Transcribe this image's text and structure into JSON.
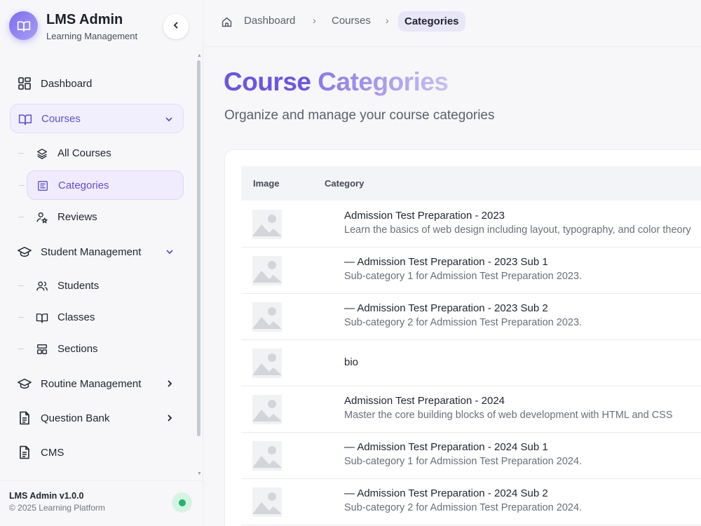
{
  "brand": {
    "title": "LMS Admin",
    "subtitle": "Learning Management",
    "logo_icon": "book-open-icon"
  },
  "nav": {
    "dashboard": "Dashboard",
    "courses": "Courses",
    "all_courses": "All Courses",
    "categories": "Categories",
    "reviews": "Reviews",
    "student_management": "Student Management",
    "students": "Students",
    "classes": "Classes",
    "sections": "Sections",
    "routine_management": "Routine Management",
    "question_bank": "Question Bank",
    "cms": "CMS"
  },
  "footer": {
    "version": "LMS Admin v1.0.0",
    "copyright": "© 2025 Learning Platform",
    "status_color": "#22b566"
  },
  "breadcrumb": {
    "items": [
      "Dashboard",
      "Courses"
    ],
    "current": "Categories"
  },
  "page": {
    "title_part1": "Course",
    "title_part2": "Categories",
    "subtitle": "Organize and manage your course categories"
  },
  "table": {
    "columns": [
      "Image",
      "Category"
    ],
    "rows": [
      {
        "name": "Admission Test Preparation - 2023",
        "description": "Learn the basics of web design including layout, typography, and color theory"
      },
      {
        "name": "— Admission Test Preparation - 2023 Sub 1",
        "description": "Sub-category 1 for Admission Test Preparation 2023."
      },
      {
        "name": "— Admission Test Preparation - 2023 Sub 2",
        "description": "Sub-category 2 for Admission Test Preparation 2023."
      },
      {
        "name": "bio",
        "description": ""
      },
      {
        "name": "Admission Test Preparation - 2024",
        "description": "Master the core building blocks of web development with HTML and CSS"
      },
      {
        "name": "— Admission Test Preparation - 2024 Sub 1",
        "description": "Sub-category 1 for Admission Test Preparation 2024."
      },
      {
        "name": "— Admission Test Preparation - 2024 Sub 2",
        "description": "Sub-category 2 for Admission Test Preparation 2024."
      }
    ]
  },
  "colors": {
    "accent": "#6a55e8",
    "active_bg": "#f1effd"
  }
}
